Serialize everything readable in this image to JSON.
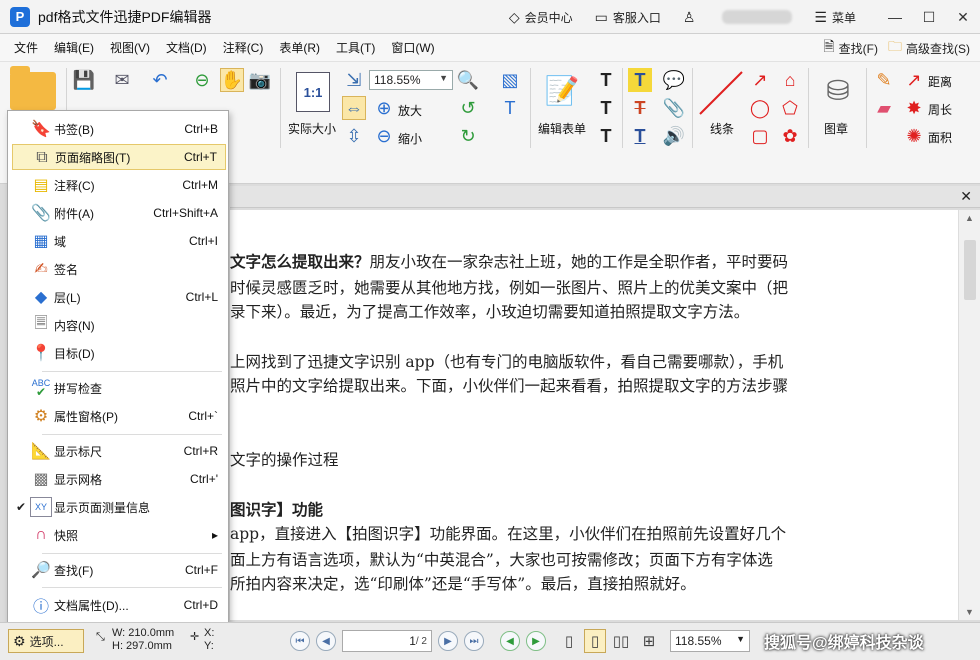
{
  "titlebar": {
    "app_title": "pdf格式文件迅捷PDF编辑器",
    "member_center": "会员中心",
    "customer_service": "客服入口",
    "menu": "菜单"
  },
  "menubar": {
    "items": [
      "文件",
      "编辑(E)",
      "视图(V)",
      "文档(D)",
      "注释(C)",
      "表单(R)",
      "工具(T)",
      "窗口(W)"
    ],
    "find": "查找(F)",
    "advanced_find": "高级查找(S)"
  },
  "ribbon": {
    "zoom_value": "118.55%",
    "zoom_in": "放大",
    "zoom_out": "缩小",
    "actual_size": "实际大小",
    "actual_size_icon_text": "1:1",
    "edit_form": "编辑表单",
    "line": "线条",
    "stamp": "图章",
    "distance": "距离",
    "perimeter": "周长",
    "area": "面积"
  },
  "context_menu": {
    "items": [
      {
        "label": "书签(B)",
        "shortcut": "Ctrl+B",
        "icon": "bookmark-icon"
      },
      {
        "label": "页面缩略图(T)",
        "shortcut": "Ctrl+T",
        "icon": "thumbnail-icon"
      },
      {
        "label": "注释(C)",
        "shortcut": "Ctrl+M",
        "icon": "comment-icon"
      },
      {
        "label": "附件(A)",
        "shortcut": "Ctrl+Shift+A",
        "icon": "paperclip-icon"
      },
      {
        "label": "域",
        "shortcut": "Ctrl+I",
        "icon": "field-icon"
      },
      {
        "label": "签名",
        "shortcut": "",
        "icon": "signature-icon"
      },
      {
        "label": "层(L)",
        "shortcut": "Ctrl+L",
        "icon": "layers-icon"
      },
      {
        "label": "内容(N)",
        "shortcut": "",
        "icon": "content-icon"
      },
      {
        "label": "目标(D)",
        "shortcut": "",
        "icon": "target-icon"
      },
      {
        "label": "拼写检查",
        "shortcut": "",
        "icon": "spellcheck-icon"
      },
      {
        "label": "属性窗格(P)",
        "shortcut": "Ctrl+`",
        "icon": "properties-icon"
      },
      {
        "label": "显示标尺",
        "shortcut": "Ctrl+R",
        "icon": "ruler-icon"
      },
      {
        "label": "显示网格",
        "shortcut": "Ctrl+'",
        "icon": "grid-icon"
      },
      {
        "label": "显示页面测量信息",
        "shortcut": "",
        "icon": "measure-icon"
      },
      {
        "label": "快照",
        "shortcut": "",
        "icon": "snapshot-icon"
      },
      {
        "label": "查找(F)",
        "shortcut": "Ctrl+F",
        "icon": "find-icon"
      },
      {
        "label": "文档属性(D)...",
        "shortcut": "Ctrl+D",
        "icon": "doc-properties-icon"
      }
    ],
    "abc_text": "ABC",
    "xy_text": "XY",
    "checkmark": "✔",
    "submenu_arrow": "▸"
  },
  "document": {
    "lines": [
      {
        "text": "文字怎么提取出来？",
        "rest": "朋友小玫在一家杂志社上班，她的工作是全职作者，平时要码"
      },
      {
        "text": "时候灵感匮乏时，她需要从其他地方找，例如一张图片、照片上的优美文案中（把"
      },
      {
        "text": "录下来）。最近，为了提高工作效率，小玫迫切需要知道拍照提取文字方法。"
      },
      {
        "text": "上网找到了迅捷文字识别 app（也有专门的电脑版软件，看自己需要哪款），手机"
      },
      {
        "text": "照片中的文字给提取出来。下面，小伙伴们一起来看看，拍照提取文字的方法步骤"
      },
      {
        "text": "文字的操作过程"
      },
      {
        "text": "图识字】功能"
      },
      {
        "text": "app，直接进入【拍图识字】功能界面。在这里，小伙伴们在拍照前先设置好几个"
      },
      {
        "text": "面上方有语言选项，默认为“中英混合”，大家也可按需修改；页面下方有字体选"
      },
      {
        "text": "所拍内容来决定，选“印刷体”还是“手写体”。最后，直接拍照就好。"
      }
    ]
  },
  "statusbar": {
    "options": "选项...",
    "width": "W: 210.0mm",
    "height": "H: 297.0mm",
    "x": "X:",
    "y": "Y:",
    "page_current": "1",
    "page_total": "/ 2",
    "zoom": "118.55%",
    "watermark": "搜狐号@绑婷科技杂谈"
  }
}
